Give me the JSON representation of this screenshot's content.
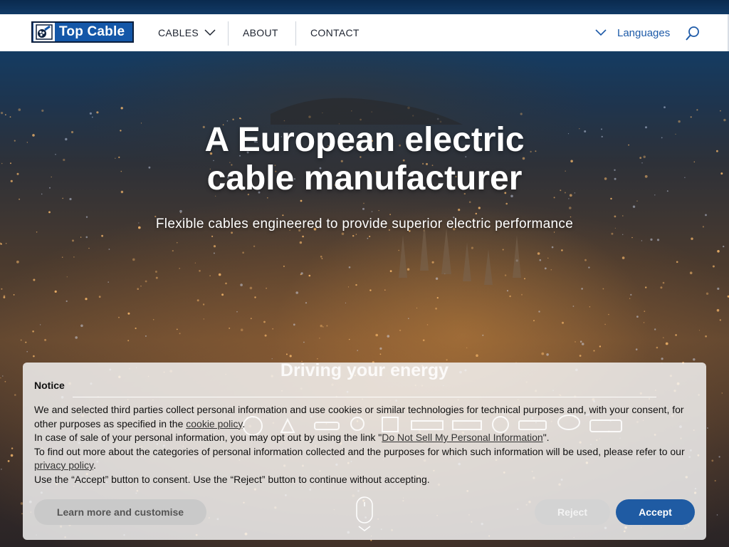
{
  "header": {
    "logo_text": "Top Cable",
    "nav": [
      {
        "label": "CABLES"
      },
      {
        "label": "ABOUT"
      },
      {
        "label": "CONTACT"
      }
    ],
    "languages_label": "Languages"
  },
  "hero": {
    "title_line1": "A European electric",
    "title_line2": "cable manufacturer",
    "subtitle": "Flexible cables engineered to provide superior electric performance",
    "section_heading": "Driving your energy"
  },
  "notice": {
    "title": "Notice",
    "p1_text": "We and selected third parties collect personal information and use cookies or similar technologies for technical purposes and, with your consent, for other purposes as specified in the ",
    "p1_link": "cookie policy",
    "p1_end": ".",
    "p2_text": "In case of sale of your personal information, you may opt out by using the link \"",
    "p2_link": "Do Not Sell My Personal Information",
    "p2_end": "\".",
    "p3_text": "To find out more about the categories of personal information collected and the purposes for which such information will be used, please refer to our ",
    "p3_link": "privacy policy",
    "p3_end": ".",
    "p4_text": "Use the “Accept” button to consent. Use the “Reject” button to continue without accepting.",
    "learn_more_label": "Learn more and customise",
    "reject_label": "Reject",
    "accept_label": "Accept"
  },
  "colors": {
    "brand_blue": "#1457a8",
    "accept_blue": "#1f5ba3",
    "link_blue": "#1d5aa8"
  },
  "icons": [
    "chevron-down-icon",
    "search-icon",
    "mouse-scroll-icon"
  ]
}
